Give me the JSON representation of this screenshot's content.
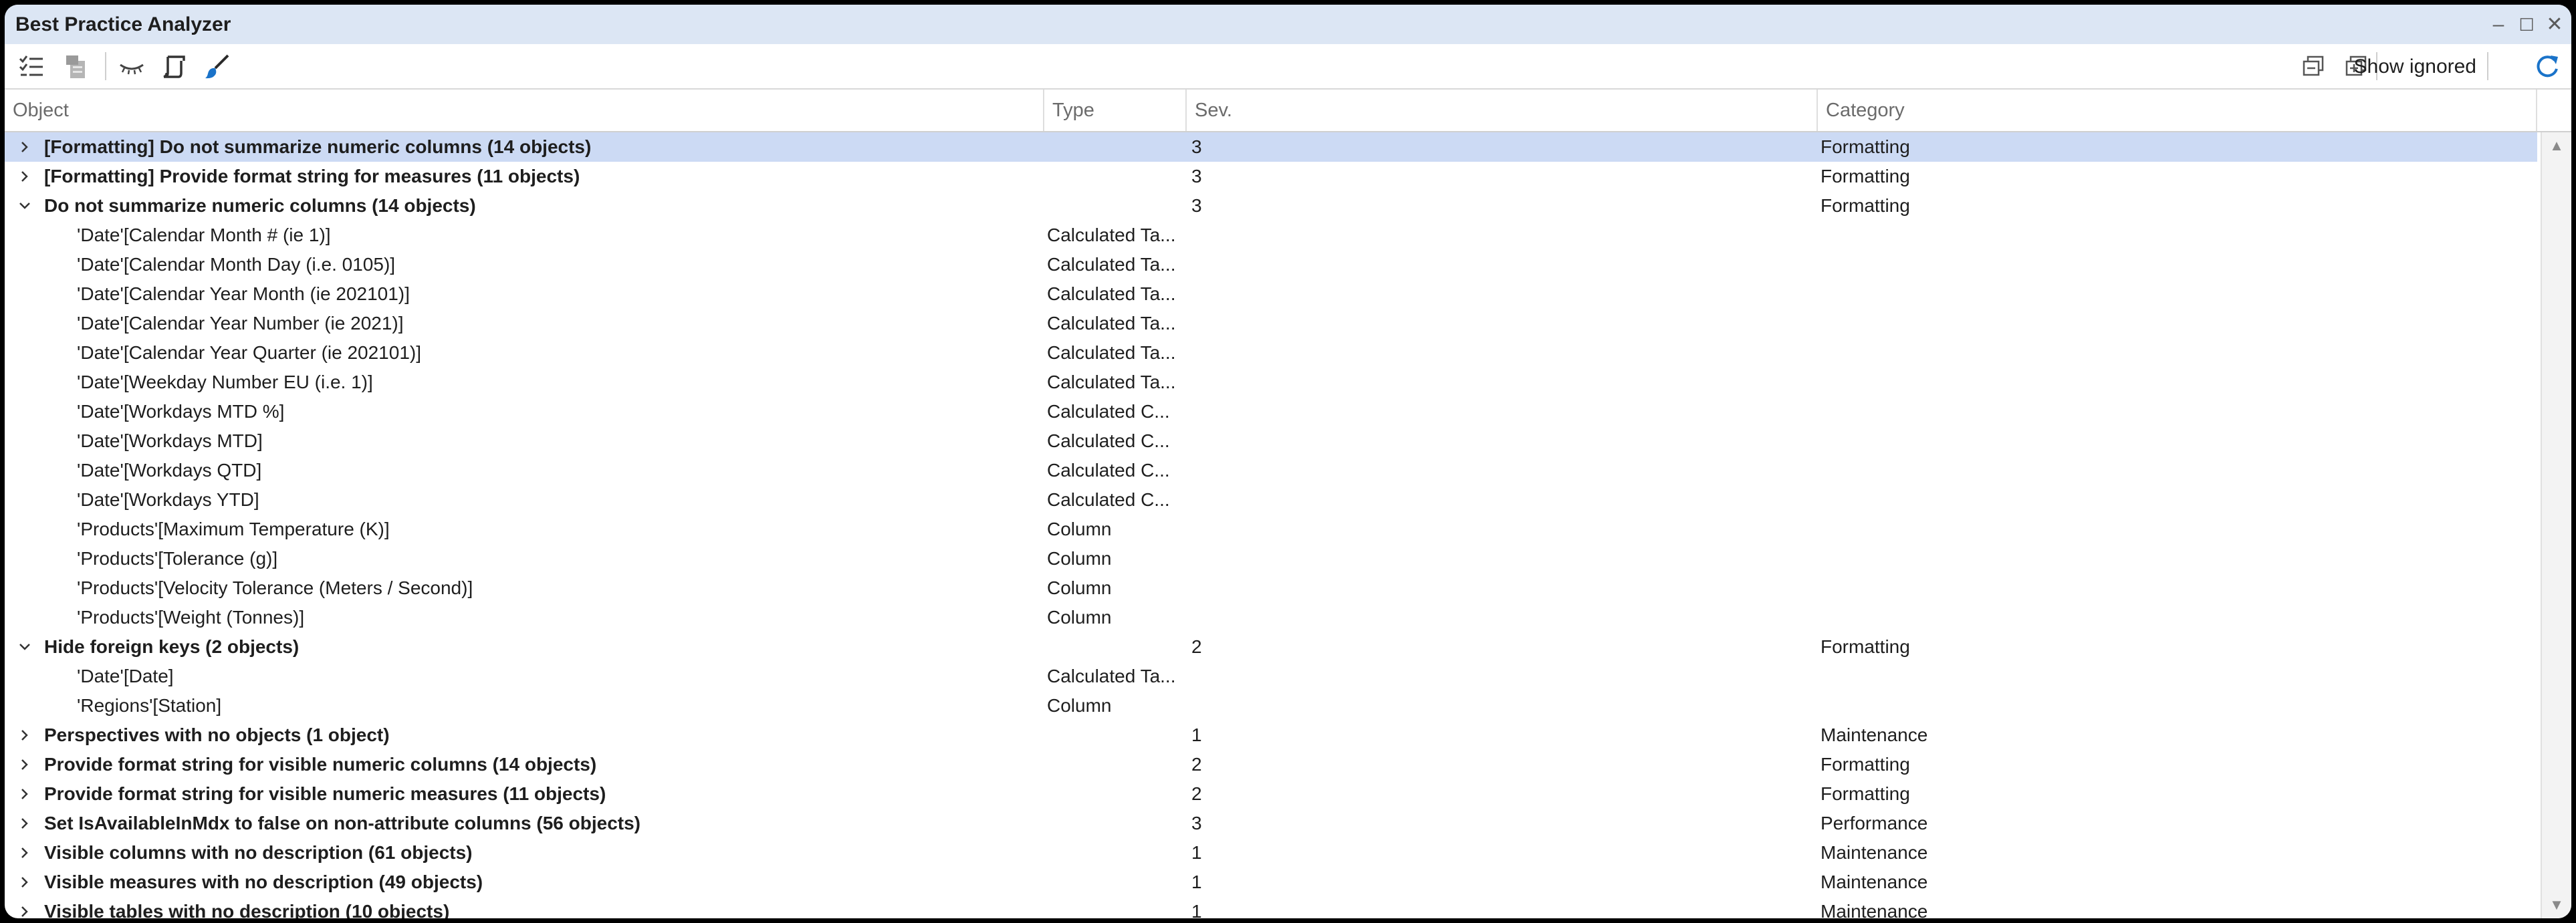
{
  "window": {
    "title": "Best Practice Analyzer",
    "minimize_glyph": "–",
    "maximize_glyph": "☐",
    "close_glyph": "✕"
  },
  "toolbar": {
    "icons": [
      "checklist-icon",
      "apply-fix-icon",
      "ignore-eye-icon",
      "script-icon",
      "brush-icon",
      "collapse-all-icon",
      "expand-all-icon",
      "refresh-icon"
    ],
    "show_ignored_label": "Show ignored",
    "accent_color": "#1a73c9"
  },
  "columns": {
    "object": "Object",
    "type": "Type",
    "severity": "Sev.",
    "category": "Category"
  },
  "rows": [
    {
      "group": true,
      "expanded": false,
      "selected": true,
      "object": "[Formatting] Do not summarize numeric columns (14 objects)",
      "type": "",
      "severity": "3",
      "category": "Formatting"
    },
    {
      "group": true,
      "expanded": false,
      "selected": false,
      "object": "[Formatting] Provide format string for measures (11 objects)",
      "type": "",
      "severity": "3",
      "category": "Formatting"
    },
    {
      "group": true,
      "expanded": true,
      "selected": false,
      "object": "Do not summarize numeric columns (14 objects)",
      "type": "",
      "severity": "3",
      "category": "Formatting"
    },
    {
      "group": false,
      "object": "'Date'[Calendar Month # (ie 1)]",
      "type": "Calculated Ta...",
      "severity": "",
      "category": ""
    },
    {
      "group": false,
      "object": "'Date'[Calendar Month Day (i.e. 0105)]",
      "type": "Calculated Ta...",
      "severity": "",
      "category": ""
    },
    {
      "group": false,
      "object": "'Date'[Calendar Year Month (ie 202101)]",
      "type": "Calculated Ta...",
      "severity": "",
      "category": ""
    },
    {
      "group": false,
      "object": "'Date'[Calendar Year Number (ie 2021)]",
      "type": "Calculated Ta...",
      "severity": "",
      "category": ""
    },
    {
      "group": false,
      "object": "'Date'[Calendar Year Quarter (ie 202101)]",
      "type": "Calculated Ta...",
      "severity": "",
      "category": ""
    },
    {
      "group": false,
      "object": "'Date'[Weekday Number EU (i.e. 1)]",
      "type": "Calculated Ta...",
      "severity": "",
      "category": ""
    },
    {
      "group": false,
      "object": "'Date'[Workdays MTD %]",
      "type": "Calculated C...",
      "severity": "",
      "category": ""
    },
    {
      "group": false,
      "object": "'Date'[Workdays MTD]",
      "type": "Calculated C...",
      "severity": "",
      "category": ""
    },
    {
      "group": false,
      "object": "'Date'[Workdays QTD]",
      "type": "Calculated C...",
      "severity": "",
      "category": ""
    },
    {
      "group": false,
      "object": "'Date'[Workdays YTD]",
      "type": "Calculated C...",
      "severity": "",
      "category": ""
    },
    {
      "group": false,
      "object": "'Products'[Maximum Temperature (K)]",
      "type": "Column",
      "severity": "",
      "category": ""
    },
    {
      "group": false,
      "object": "'Products'[Tolerance (g)]",
      "type": "Column",
      "severity": "",
      "category": ""
    },
    {
      "group": false,
      "object": "'Products'[Velocity Tolerance (Meters / Second)]",
      "type": "Column",
      "severity": "",
      "category": ""
    },
    {
      "group": false,
      "object": "'Products'[Weight (Tonnes)]",
      "type": "Column",
      "severity": "",
      "category": ""
    },
    {
      "group": true,
      "expanded": true,
      "selected": false,
      "object": "Hide foreign keys (2 objects)",
      "type": "",
      "severity": "2",
      "category": "Formatting"
    },
    {
      "group": false,
      "object": "'Date'[Date]",
      "type": "Calculated Ta...",
      "severity": "",
      "category": ""
    },
    {
      "group": false,
      "object": "'Regions'[Station]",
      "type": "Column",
      "severity": "",
      "category": ""
    },
    {
      "group": true,
      "expanded": false,
      "selected": false,
      "object": "Perspectives with no objects (1 object)",
      "type": "",
      "severity": "1",
      "category": "Maintenance"
    },
    {
      "group": true,
      "expanded": false,
      "selected": false,
      "object": "Provide format string for visible numeric columns (14 objects)",
      "type": "",
      "severity": "2",
      "category": "Formatting"
    },
    {
      "group": true,
      "expanded": false,
      "selected": false,
      "object": "Provide format string for visible numeric measures (11 objects)",
      "type": "",
      "severity": "2",
      "category": "Formatting"
    },
    {
      "group": true,
      "expanded": false,
      "selected": false,
      "object": "Set IsAvailableInMdx to false on non-attribute columns (56 objects)",
      "type": "",
      "severity": "3",
      "category": "Performance"
    },
    {
      "group": true,
      "expanded": false,
      "selected": false,
      "object": "Visible columns with no description (61 objects)",
      "type": "",
      "severity": "1",
      "category": "Maintenance"
    },
    {
      "group": true,
      "expanded": false,
      "selected": false,
      "object": "Visible measures with no description (49 objects)",
      "type": "",
      "severity": "1",
      "category": "Maintenance"
    },
    {
      "group": true,
      "expanded": false,
      "selected": false,
      "object": "Visible tables with no description (10 objects)",
      "type": "",
      "severity": "1",
      "category": "Maintenance"
    }
  ],
  "scrollbar": {
    "up_glyph": "▲",
    "down_glyph": "▼"
  }
}
